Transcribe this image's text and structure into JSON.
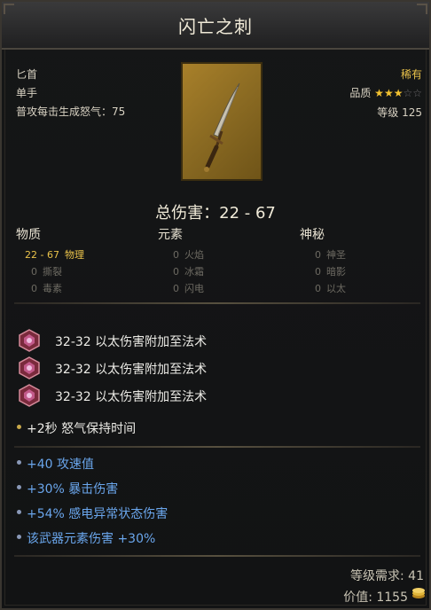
{
  "item": {
    "name": "闪亡之刺",
    "type": "匕首",
    "hand": "单手",
    "rage_gen": "普攻每击生成怒气：75",
    "rarity": "稀有",
    "quality_label": "品质",
    "quality_stars": 3,
    "quality_max": 5,
    "level_text": "等级 125",
    "total_damage": "总伤害：22 - 67"
  },
  "damage": {
    "columns": [
      {
        "title": "物质",
        "rows": [
          {
            "value": "22 - 67",
            "label": "物理",
            "active": true
          },
          {
            "value": "0",
            "label": "撕裂",
            "active": false
          },
          {
            "value": "0",
            "label": "毒素",
            "active": false
          }
        ]
      },
      {
        "title": "元素",
        "rows": [
          {
            "value": "0",
            "label": "火焰",
            "active": false
          },
          {
            "value": "0",
            "label": "冰霜",
            "active": false
          },
          {
            "value": "0",
            "label": "闪电",
            "active": false
          }
        ]
      },
      {
        "title": "神秘",
        "rows": [
          {
            "value": "0",
            "label": "神圣",
            "active": false
          },
          {
            "value": "0",
            "label": "暗影",
            "active": false
          },
          {
            "value": "0",
            "label": "以太",
            "active": false
          }
        ]
      }
    ]
  },
  "gems": [
    "32-32 以太伤害附加至法术",
    "32-32 以太伤害附加至法术",
    "32-32 以太伤害附加至法术"
  ],
  "base_stat": "+2秒 怒气保持时间",
  "bonus_stats": [
    "+40 攻速值",
    "+30% 暴击伤害",
    "+54% 感电异常状态伤害",
    "该武器元素伤害 +30%"
  ],
  "footer": {
    "level_req": "等级需求: 41",
    "value": "价值: 1155"
  },
  "colors": {
    "rarity": "#e9c24a",
    "stat_blue": "#6aa6ec",
    "active_damage": "#e9c24a",
    "inactive_damage": "#6d6a62"
  },
  "icons": {
    "gem": "ether-gem-icon",
    "coin": "gold-coins-icon",
    "bullet": "bullet-dot-icon"
  }
}
